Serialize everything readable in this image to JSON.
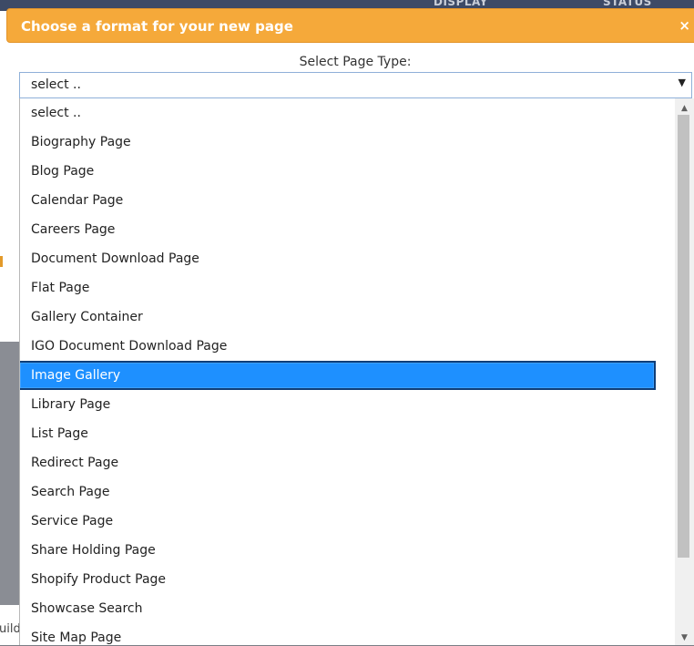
{
  "background": {
    "columns": [
      "DISPLAY",
      "STATUS"
    ],
    "fragment_text": "uild"
  },
  "modal": {
    "title": "Choose a format for your new page",
    "close_label": "×",
    "field_label": "Select Page Type:",
    "select": {
      "value": "select ..",
      "arrow": "▼",
      "expanded": true
    }
  },
  "dropdown": {
    "selected_index": 9,
    "options": [
      "select ..",
      "Biography Page",
      "Blog Page",
      "Calendar Page",
      "Careers Page",
      "Document Download Page",
      "Flat Page",
      "Gallery Container",
      "IGO Document Download Page",
      "Image Gallery",
      "Library Page",
      "List Page",
      "Redirect Page",
      "Search Page",
      "Service Page",
      "Share Holding Page",
      "Shopify Product Page",
      "Showcase Search",
      "Site Map Page"
    ],
    "scroll_up": "▲",
    "scroll_down": "▼"
  },
  "colors": {
    "header_orange": "#f5a93a",
    "selection_blue": "#1e90ff"
  }
}
